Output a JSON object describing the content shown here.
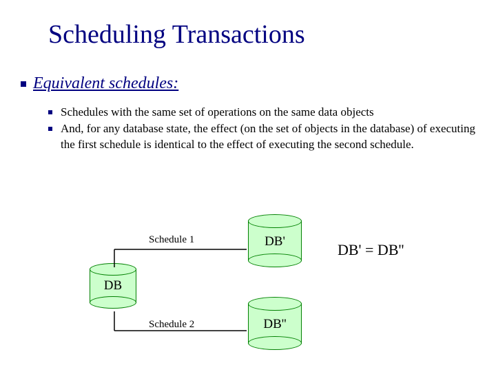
{
  "title": "Scheduling Transactions",
  "heading": "Equivalent schedules:",
  "bullets": {
    "b1": "Schedules with the same set of operations on the same data objects",
    "b2": "And, for any database state, the effect (on the set of objects in the database) of executing the first schedule is identical to the effect of executing the second schedule."
  },
  "diagram": {
    "db": "DB",
    "dbp1": "DB'",
    "dbp2": "DB''",
    "sched1": "Schedule 1",
    "sched2": "Schedule 2",
    "equation": "DB' = DB''"
  }
}
